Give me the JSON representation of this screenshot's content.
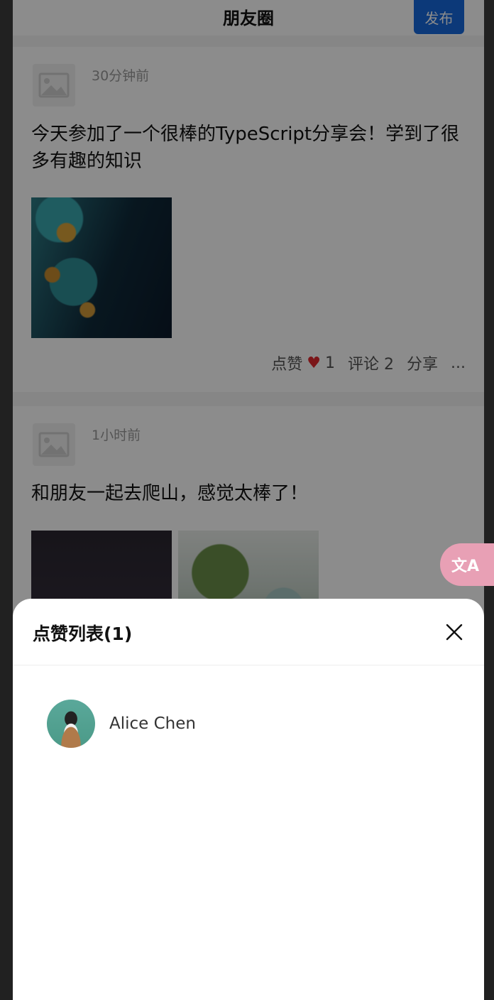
{
  "header": {
    "title": "朋友圈",
    "publish_label": "发布"
  },
  "posts": [
    {
      "time": "30分钟前",
      "content": "今天参加了一个很棒的TypeScript分享会！学到了很多有趣的知识",
      "actions": {
        "like_label": "点赞",
        "like_count": "1",
        "comment_label": "评论 2",
        "share_label": "分享",
        "more_label": "..."
      }
    },
    {
      "time": "1小时前",
      "content": "和朋友一起去爬山，感觉太棒了！"
    }
  ],
  "translate_fab": {
    "label": "文A",
    "icon": "translate-icon",
    "color": "#e8a0b5"
  },
  "likes_sheet": {
    "title": "点赞列表(1)",
    "users": [
      {
        "name": "Alice Chen"
      }
    ]
  },
  "colors": {
    "accent": "#1668dc",
    "like_heart": "#e0282e"
  }
}
